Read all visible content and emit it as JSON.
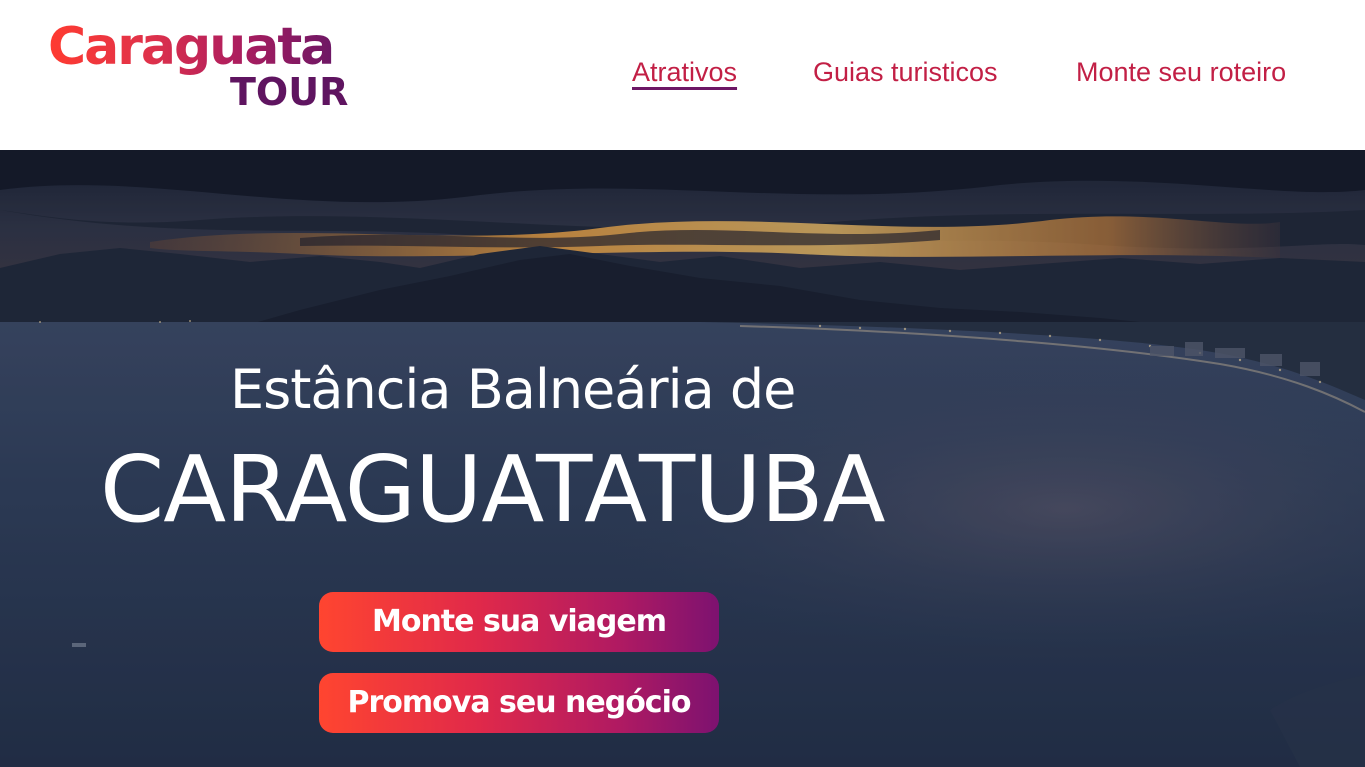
{
  "logo": {
    "top_text": "Caraguata",
    "bottom_text": "TOUR"
  },
  "nav": {
    "items": [
      {
        "label": "Atrativos",
        "active": true
      },
      {
        "label": "Guias turisticos",
        "active": false
      },
      {
        "label": "Monte seu roteiro",
        "active": false
      }
    ]
  },
  "hero": {
    "subtitle": "Estância Balneária de",
    "title": "CARAGUATATUBA",
    "primary_cta": "Monte sua viagem",
    "secondary_cta": "Promova seu negócio"
  },
  "colors": {
    "brand_red": "#ff3b30",
    "brand_purple": "#5f1460",
    "nav_text": "#c21f45"
  }
}
